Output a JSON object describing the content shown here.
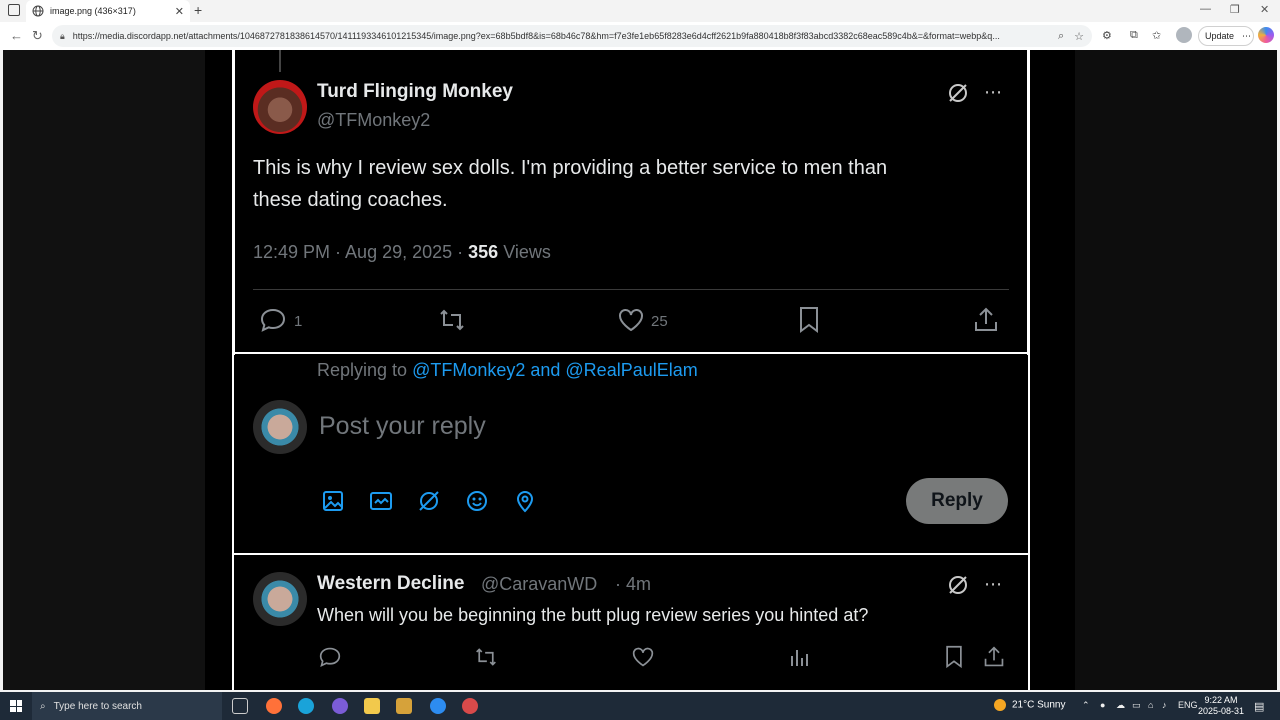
{
  "browser": {
    "tab_title": "image.png (436×317)",
    "url": "https://media.discordapp.net/attachments/1046872781838614570/1411193346101215345/image.png?ex=68b5bdf8&is=68b46c78&hm=f7e3fe1eb65f8283e6d4cff2621b9fa880418b8f3f83abcd3382c68eac589c4b&=&format=webp&q...",
    "update_label": "Update"
  },
  "tweet": {
    "name": "Turd Flinging Monkey",
    "handle": "@TFMonkey2",
    "text_line1": "This is why I review sex dolls. I'm providing a better service to men than",
    "text_line2": "these dating coaches.",
    "time": "12:49 PM · Aug 29, 2025 ·",
    "views_count": "356",
    "views_label": "Views",
    "reply_count": "1",
    "like_count": "25"
  },
  "composer": {
    "replying_prefix": "Replying to",
    "replying_users": "@TFMonkey2 and @RealPaulElam",
    "placeholder": "Post your reply",
    "reply_button": "Reply",
    "accent": "#1d9bf0"
  },
  "reply": {
    "name": "Western Decline",
    "handle": "@CaravanWD",
    "age": "· 4m",
    "text": "When will you be beginning the butt plug review series you hinted at?"
  },
  "taskbar": {
    "search_placeholder": "Type here to search",
    "weather": "21°C  Sunny",
    "lang": "ENG",
    "time": "9:22 AM",
    "date": "2025-08-31"
  }
}
